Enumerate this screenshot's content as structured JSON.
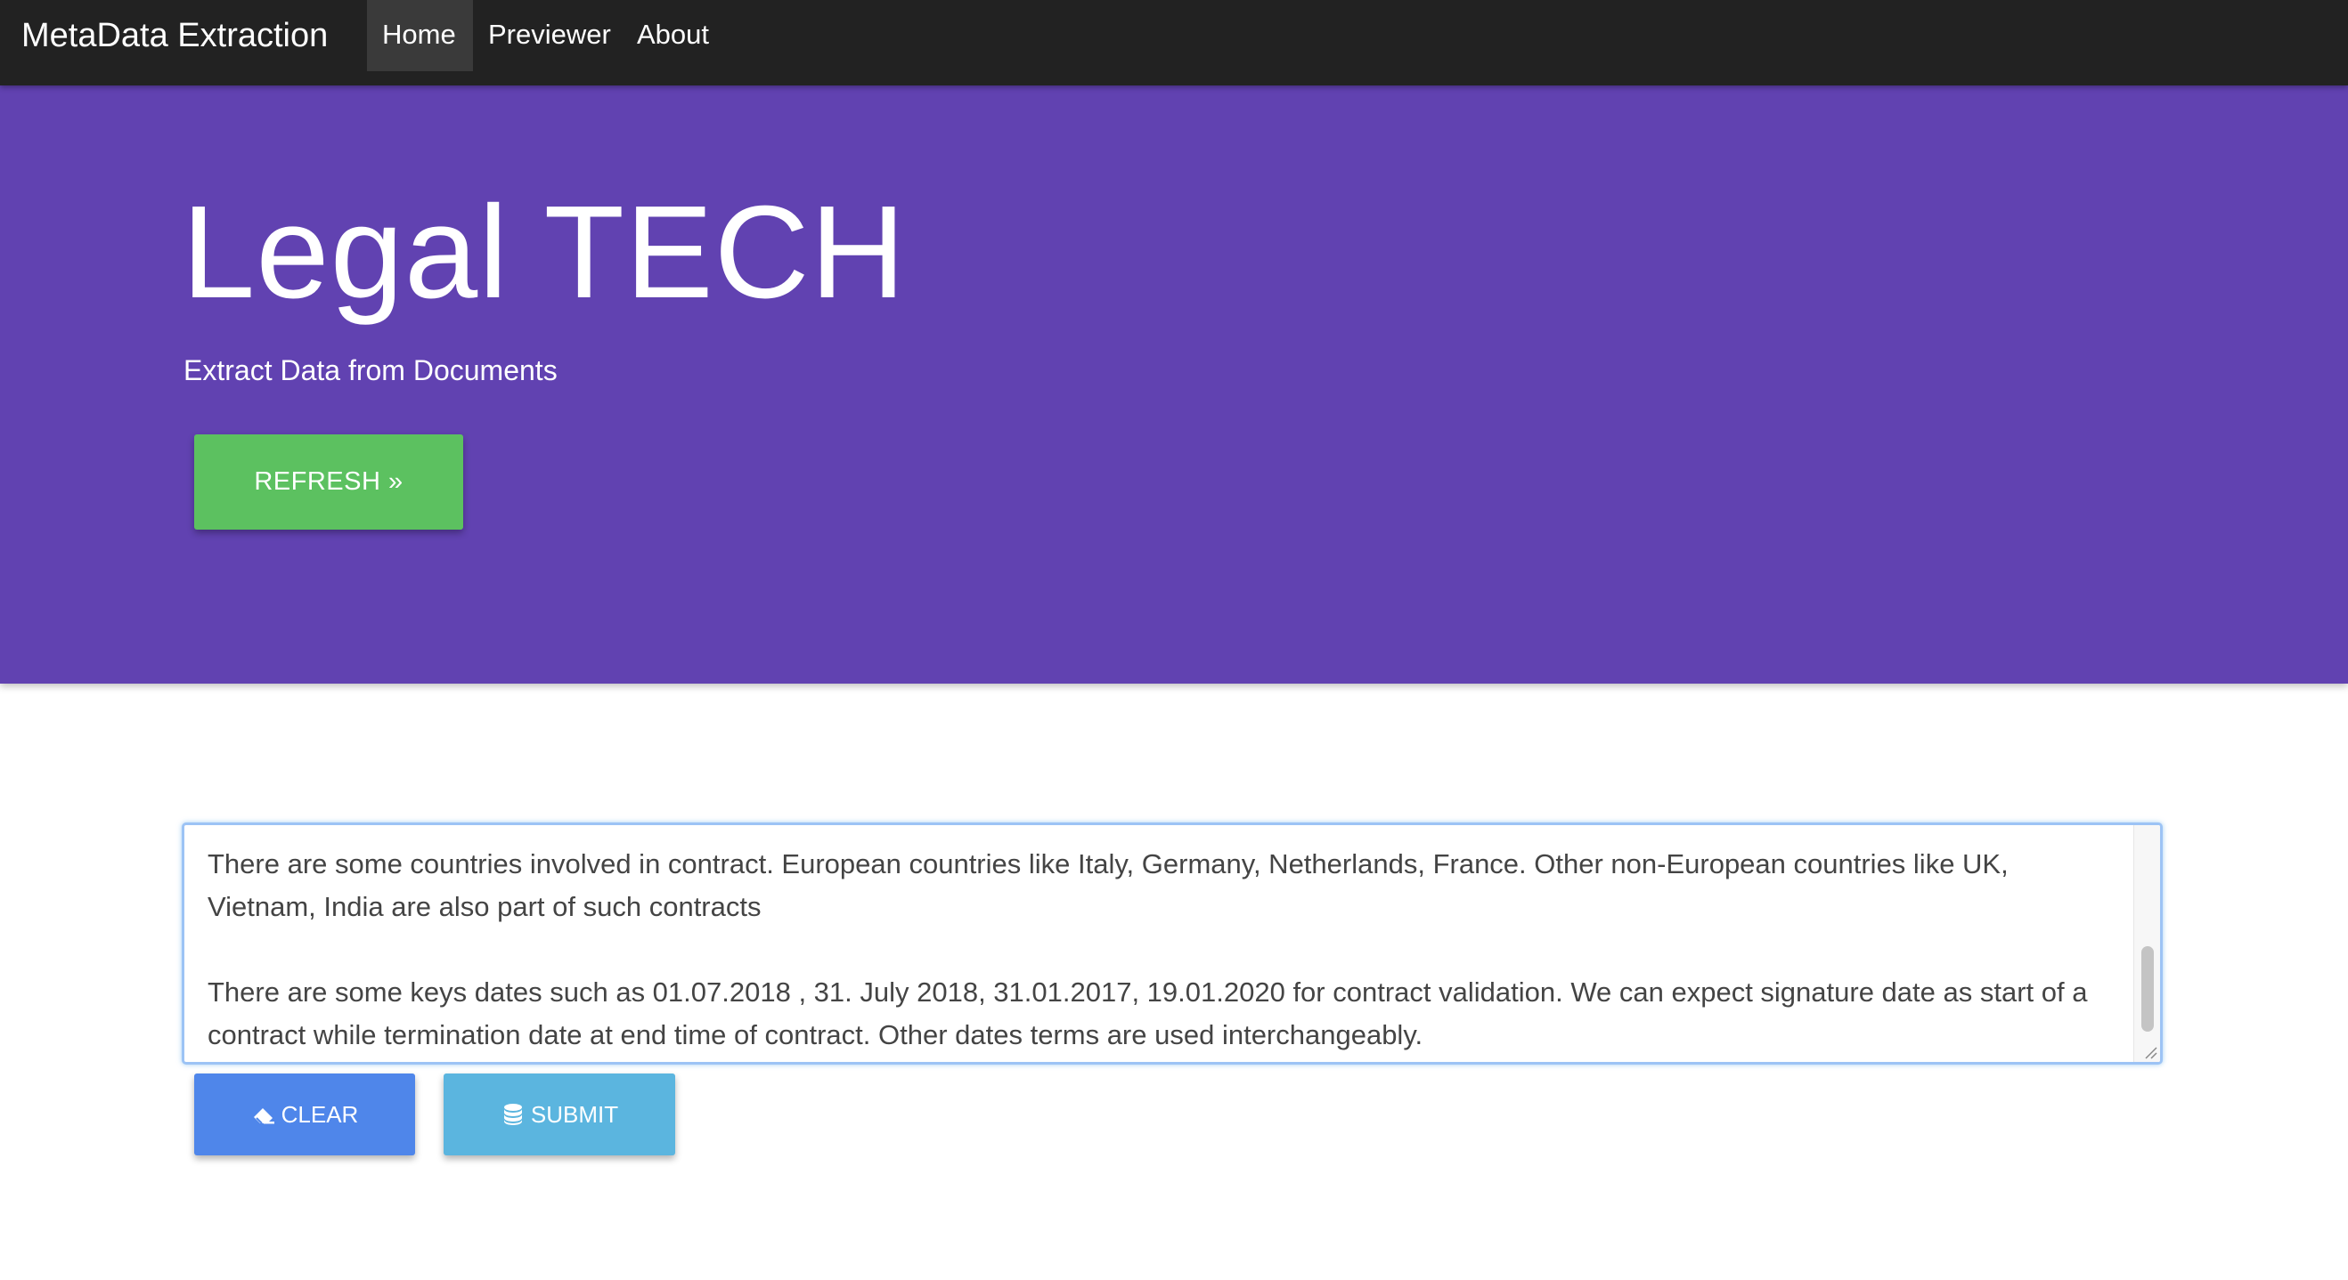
{
  "navbar": {
    "brand": "MetaData Extraction",
    "items": [
      {
        "label": "Home",
        "active": true
      },
      {
        "label": "Previewer",
        "active": false
      },
      {
        "label": "About",
        "active": false
      }
    ]
  },
  "hero": {
    "title": "Legal TECH",
    "subtitle": "Extract Data from Documents",
    "refresh_label": "REFRESH »",
    "background_color": "#6142b1",
    "button_color": "#5cc160"
  },
  "input": {
    "text": "There are some countries involved in contract. European countries like Italy, Germany, Netherlands, France. Other non-European countries like UK, Vietnam, India are also part of such contracts\n\nThere are some keys dates such as 01.07.2018 , 31. July 2018, 31.01.2017, 19.01.2020 for contract validation. We can expect signature date as start of a contract while termination date at end time of contract. Other dates terms are used interchangeably."
  },
  "actions": {
    "clear_label": "CLEAR",
    "clear_icon": "eraser-icon",
    "submit_label": "SUBMIT",
    "submit_icon": "database-icon",
    "clear_color": "#4f86ea",
    "submit_color": "#5bb5df"
  }
}
